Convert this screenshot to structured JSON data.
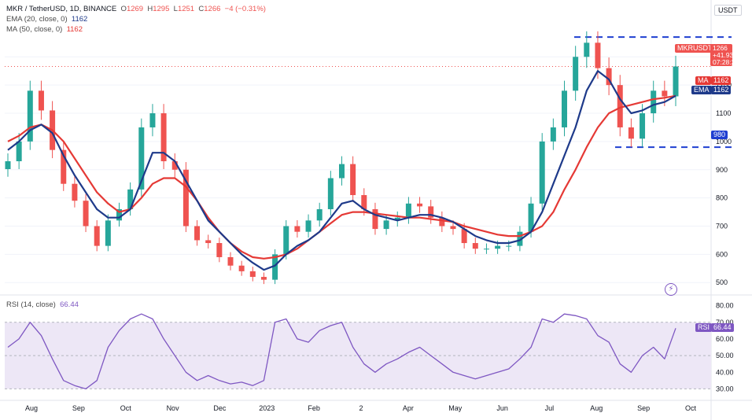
{
  "colors": {
    "up": "#26a69a",
    "down": "#ef5350",
    "ma": "#e53935",
    "ema": "#1e3a8a",
    "rsi": "#7e57c2",
    "rsi_band": "#ede7f6",
    "level_line": "#1f3fd1",
    "grid": "#f0f3fa"
  },
  "legend": {
    "symbol": "MKR / TetherUSD, 1D, BINANCE",
    "o_label": "O",
    "o_value": "1269",
    "h_label": "H",
    "h_value": "1295",
    "l_label": "L",
    "l_value": "1251",
    "c_label": "C",
    "c_value": "1266",
    "change": "−4 (−0.31%)",
    "ema_label": "EMA (20, close, 0)",
    "ema_value": "1162",
    "ma_label": "MA (50, close, 0)",
    "ma_value": "1162",
    "rsi_label": "RSI (14, close)",
    "rsi_value": "66.44"
  },
  "price_axis": {
    "currency": "USDT",
    "ticks": [
      "1300",
      "1200",
      "1100",
      "1000",
      "900",
      "800",
      "700",
      "600",
      "500"
    ]
  },
  "rsi_axis": {
    "ticks": [
      "80.00",
      "70.00",
      "60.00",
      "50.00",
      "40.00",
      "30.00"
    ]
  },
  "time_axis": {
    "ticks": [
      "Aug",
      "Sep",
      "Oct",
      "Nov",
      "Dec",
      "2023",
      "Feb",
      "2",
      "Apr",
      "May",
      "Jun",
      "Jul",
      "Aug",
      "Sep",
      "Oct"
    ]
  },
  "tags": {
    "price_symbol": "MKRUSDT",
    "price_value": "1266",
    "price_change": "+41.93%",
    "price_timer": "07:28:25",
    "ma_label": "MA",
    "ma_value": "1162",
    "ema_label": "EMA",
    "ema_value": "1162",
    "level_value": "980",
    "rsi_label": "RSI",
    "rsi_value": "66.44"
  },
  "chart_data": {
    "type": "line",
    "title": "MKR / TetherUSD, 1D, BINANCE",
    "price_ylim": [
      470,
      1390
    ],
    "rsi_ylim": [
      25,
      85
    ],
    "x": [
      "2022-07-25",
      "2022-08-01",
      "2022-08-08",
      "2022-08-15",
      "2022-08-22",
      "2022-08-29",
      "2022-09-05",
      "2022-09-12",
      "2022-09-19",
      "2022-09-26",
      "2022-10-03",
      "2022-10-10",
      "2022-10-17",
      "2022-10-24",
      "2022-10-31",
      "2022-11-07",
      "2022-11-14",
      "2022-11-21",
      "2022-11-28",
      "2022-12-05",
      "2022-12-12",
      "2022-12-19",
      "2022-12-26",
      "2023-01-02",
      "2023-01-09",
      "2023-01-16",
      "2023-01-23",
      "2023-01-30",
      "2023-02-06",
      "2023-02-13",
      "2023-02-20",
      "2023-02-27",
      "2023-03-06",
      "2023-03-13",
      "2023-03-20",
      "2023-03-27",
      "2023-04-03",
      "2023-04-10",
      "2023-04-17",
      "2023-04-24",
      "2023-05-01",
      "2023-05-08",
      "2023-05-15",
      "2023-05-22",
      "2023-05-29",
      "2023-06-05",
      "2023-06-12",
      "2023-06-19",
      "2023-06-26",
      "2023-07-03",
      "2023-07-10",
      "2023-07-17",
      "2023-07-24",
      "2023-07-31",
      "2023-08-07",
      "2023-08-14",
      "2023-08-21",
      "2023-08-28",
      "2023-09-04",
      "2023-09-11",
      "2023-09-18"
    ],
    "series": [
      {
        "name": "MKRUSDT",
        "values": [
          930,
          1000,
          1180,
          1110,
          970,
          850,
          790,
          700,
          630,
          720,
          760,
          830,
          1050,
          1100,
          930,
          900,
          700,
          650,
          640,
          590,
          560,
          540,
          520,
          510,
          600,
          700,
          680,
          720,
          760,
          870,
          920,
          810,
          760,
          690,
          720,
          730,
          780,
          770,
          730,
          700,
          690,
          640,
          620,
          620,
          630,
          630,
          680,
          780,
          1000,
          1050,
          1180,
          1300,
          1350,
          1260,
          1200,
          1050,
          1010,
          1100,
          1180,
          1160,
          1266
        ]
      },
      {
        "name": "EMA (20, close, 0)",
        "values": [
          970,
          1000,
          1040,
          1060,
          1030,
          950,
          880,
          820,
          760,
          730,
          730,
          760,
          860,
          960,
          960,
          930,
          860,
          790,
          720,
          680,
          640,
          600,
          570,
          545,
          560,
          600,
          630,
          650,
          680,
          730,
          780,
          790,
          760,
          740,
          730,
          720,
          730,
          740,
          740,
          730,
          715,
          690,
          665,
          650,
          640,
          640,
          650,
          680,
          750,
          850,
          950,
          1050,
          1180,
          1250,
          1220,
          1150,
          1100,
          1110,
          1130,
          1140,
          1162
        ]
      },
      {
        "name": "MA (50, close, 0)",
        "values": [
          1000,
          1020,
          1050,
          1060,
          1040,
          1000,
          940,
          880,
          820,
          780,
          750,
          760,
          800,
          850,
          870,
          870,
          840,
          790,
          730,
          680,
          640,
          610,
          590,
          585,
          590,
          600,
          620,
          650,
          680,
          710,
          740,
          750,
          750,
          745,
          740,
          735,
          730,
          730,
          725,
          720,
          715,
          700,
          690,
          680,
          670,
          665,
          665,
          680,
          700,
          750,
          830,
          900,
          980,
          1050,
          1100,
          1120,
          1130,
          1140,
          1150,
          1155,
          1162
        ]
      },
      {
        "name": "RSI (14, close)",
        "values": [
          55,
          60,
          70,
          62,
          48,
          35,
          32,
          30,
          35,
          55,
          65,
          72,
          75,
          72,
          60,
          50,
          40,
          35,
          38,
          35,
          33,
          34,
          32,
          35,
          70,
          72,
          60,
          58,
          65,
          68,
          70,
          55,
          45,
          40,
          45,
          48,
          52,
          55,
          50,
          45,
          40,
          38,
          36,
          38,
          40,
          42,
          48,
          55,
          72,
          70,
          75,
          74,
          72,
          62,
          58,
          45,
          40,
          50,
          55,
          48,
          66.44
        ]
      }
    ],
    "horizontal_levels": [
      1370,
      980
    ]
  }
}
